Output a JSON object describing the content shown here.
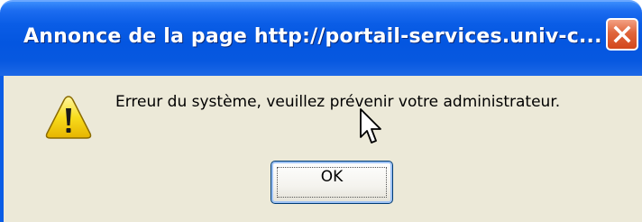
{
  "window": {
    "title": "Annonce de la page http://portail-services.univ-c...",
    "close_icon": "close-icon"
  },
  "dialog": {
    "icon": "warning-icon",
    "message": "Erreur du système, veuillez prévenir votre administrateur.",
    "ok_label": "OK"
  },
  "colors": {
    "titlebar": "#0456e0",
    "body_background": "#ece9d8",
    "close_button": "#d2471c",
    "warning_fill": "#f5d400"
  }
}
